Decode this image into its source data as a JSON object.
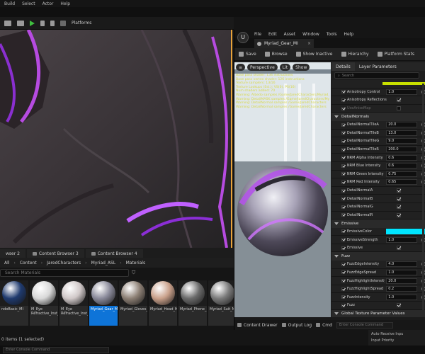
{
  "main": {
    "menu": [
      "Build",
      "Select",
      "Actor",
      "Help"
    ],
    "platforms_label": "Platforms"
  },
  "browser": {
    "tabs": [
      "wser 2",
      "Content Browser 3",
      "Content Browser 4"
    ],
    "path": [
      "All",
      "Content",
      "JaredCharacters",
      "Myriad_ASL",
      "Materials"
    ],
    "search_placeholder": "Search Materials",
    "assets": [
      {
        "label": "ndoBasic_MI",
        "color": "#1f3a6e",
        "selected": false
      },
      {
        "label": "M_Eye Refractive_Inst_L",
        "color": "#d8d8d8",
        "selected": false
      },
      {
        "label": "M_Eye Refractive_Inst_R",
        "color": "#d0c8c8",
        "selected": false
      },
      {
        "label": "Myriad_Gear_MI",
        "color": "#8a8a9a",
        "selected": true
      },
      {
        "label": "Myriad_Gloves_MI",
        "color": "#8c7f74",
        "selected": false
      },
      {
        "label": "Myriad_Head_MI",
        "color": "#c9a08a",
        "selected": false
      },
      {
        "label": "Myriad_Phone_MI",
        "color": "#6a6a6a",
        "selected": false
      },
      {
        "label": "Myriad_Suit_MI",
        "color": "#7a7a7a",
        "selected": false
      }
    ],
    "status": "0 items (1 selected)"
  },
  "bottom": {
    "cmd_placeholder": "Enter Console Command"
  },
  "material_editor": {
    "menu": [
      "File",
      "Edit",
      "Asset",
      "Window",
      "Tools",
      "Help"
    ],
    "tab_title": "Myriad_Gear_MI",
    "toolbar": [
      "Save",
      "Browse",
      "Show Inactive",
      "Hierarchy",
      "Platform Stats"
    ],
    "preview_buttons": [
      "Perspective",
      "Lit",
      "Show"
    ],
    "stats": [
      "Base pass shader: 134 instructions",
      "Base pass vertex shader: 126 instructions",
      "Texture samplers: 13/16",
      "Texture Lookups (Est.): VS(0), PS(16)",
      "Num shaders added: 70",
      "Warning: Albedo samples /Game/JaredCharacters/Myriad_ASL",
      "Warning: DetailMASK samples /Game/JaredCharacters/Myriad_ASL",
      "Warning: DetailNormal samples /Game/JaredCharacters",
      "Warning: DetailNormal samples /Game/JaredCharacters"
    ],
    "details_tabs": [
      "Details",
      "Layer Parameters"
    ],
    "details_search": "Search",
    "rows": [
      {
        "kind": "bar",
        "name": ""
      },
      {
        "kind": "num",
        "name": "Anisotropy Control",
        "value": "1.0"
      },
      {
        "kind": "bool",
        "name": "Anisotropy Reflections",
        "on": true
      },
      {
        "kind": "bool",
        "name": "UseAnisoMap",
        "on": false,
        "dim": true
      },
      {
        "kind": "cat",
        "name": "DetailNormals"
      },
      {
        "kind": "num",
        "name": "DetailNormalTileA",
        "value": "20.0"
      },
      {
        "kind": "num",
        "name": "DetailNormalTileB",
        "value": "13.0"
      },
      {
        "kind": "num",
        "name": "DetailNormalTileG",
        "value": "9.0"
      },
      {
        "kind": "num",
        "name": "DetailNormalTileR",
        "value": "200.0"
      },
      {
        "kind": "num",
        "name": "NRM Alpha Intensity",
        "value": "0.6"
      },
      {
        "kind": "num",
        "name": "NRM Blue Intensity",
        "value": "0.6"
      },
      {
        "kind": "num",
        "name": "NRM Green Intensity",
        "value": "0.75"
      },
      {
        "kind": "num",
        "name": "NRM Red Intensity",
        "value": "0.65"
      },
      {
        "kind": "bool",
        "name": "DetailNormalA",
        "on": true
      },
      {
        "kind": "bool",
        "name": "DetailNormalB",
        "on": true
      },
      {
        "kind": "bool",
        "name": "DetailNormalG",
        "on": true
      },
      {
        "kind": "bool",
        "name": "DetailNormalR",
        "on": true
      },
      {
        "kind": "cat",
        "name": "Emissive"
      },
      {
        "kind": "color",
        "name": "EmissiveColor"
      },
      {
        "kind": "num",
        "name": "EmissiveStrength",
        "value": "1.0"
      },
      {
        "kind": "bool",
        "name": "Emissive",
        "on": true
      },
      {
        "kind": "cat",
        "name": "Fuzz"
      },
      {
        "kind": "num",
        "name": "FuzzEdgeIntensity",
        "value": "4.0"
      },
      {
        "kind": "num",
        "name": "FuzzEdgeSpread",
        "value": "1.0"
      },
      {
        "kind": "num",
        "name": "FuzzHighlightIntensity",
        "value": "20.0"
      },
      {
        "kind": "num",
        "name": "FuzzHighlightSpread",
        "value": "0.2"
      },
      {
        "kind": "num",
        "name": "FuzzIntensity",
        "value": "1.0"
      },
      {
        "kind": "bool",
        "name": "Fuzz",
        "on": true
      },
      {
        "kind": "cat",
        "name": "Global Texture Parameter Values"
      }
    ],
    "bottom": [
      "Content Drawer",
      "Output Log",
      "Cmd"
    ],
    "cmd_placeholder": "Enter Console Command"
  },
  "under_panel": [
    "Auto Receive Inpu",
    "Input Priority"
  ],
  "colors": {
    "accent": "#0e74d8",
    "viewport_border": "#e8a33a",
    "emissive_swatch": "#00e5ff",
    "stats_text": "#d8d84a"
  }
}
